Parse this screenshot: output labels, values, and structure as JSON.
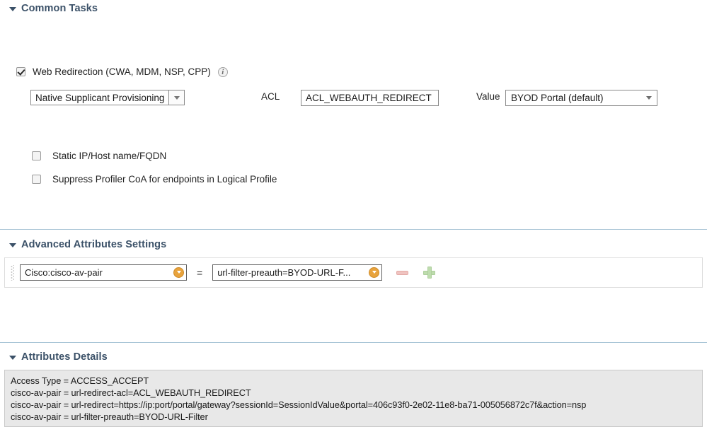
{
  "sections": {
    "common_tasks": {
      "title": "Common Tasks",
      "web_redirection": {
        "label": "Web Redirection (CWA, MDM, NSP, CPP)",
        "checked": true,
        "info_icon": "info-icon",
        "type_select": "Native Supplicant Provisioning",
        "acl_label": "ACL",
        "acl_value": "ACL_WEBAUTH_REDIRECT",
        "value_label": "Value",
        "value_select": "BYOD Portal (default)"
      },
      "checkboxes": [
        {
          "label": "Static IP/Host name/FQDN",
          "checked": false
        },
        {
          "label": "Suppress Profiler CoA for endpoints in Logical Profile",
          "checked": false
        }
      ]
    },
    "advanced_attributes": {
      "title": "Advanced Attributes Settings",
      "rows": [
        {
          "attribute": "Cisco:cisco-av-pair",
          "operator": "=",
          "value": "url-filter-preauth=BYOD-URL-F...",
          "remove_label": "remove-attribute",
          "add_label": "add-attribute"
        }
      ]
    },
    "attributes_details": {
      "title": "Attributes Details",
      "lines": [
        "Access Type = ACCESS_ACCEPT",
        "cisco-av-pair = url-redirect-acl=ACL_WEBAUTH_REDIRECT",
        "cisco-av-pair = url-redirect=https://ip:port/portal/gateway?sessionId=SessionIdValue&portal=406c93f0-2e02-11e8-ba71-005056872c7f&action=nsp",
        "cisco-av-pair = url-filter-preauth=BYOD-URL-Filter"
      ]
    }
  },
  "colors": {
    "section_title": "#3b5168",
    "section_rule": "#a8c4d6",
    "details_background": "#e8e8e8",
    "dropdown_accent": "#e8a33d",
    "remove_button": "#efc3c0",
    "add_button": "#bedcae"
  }
}
